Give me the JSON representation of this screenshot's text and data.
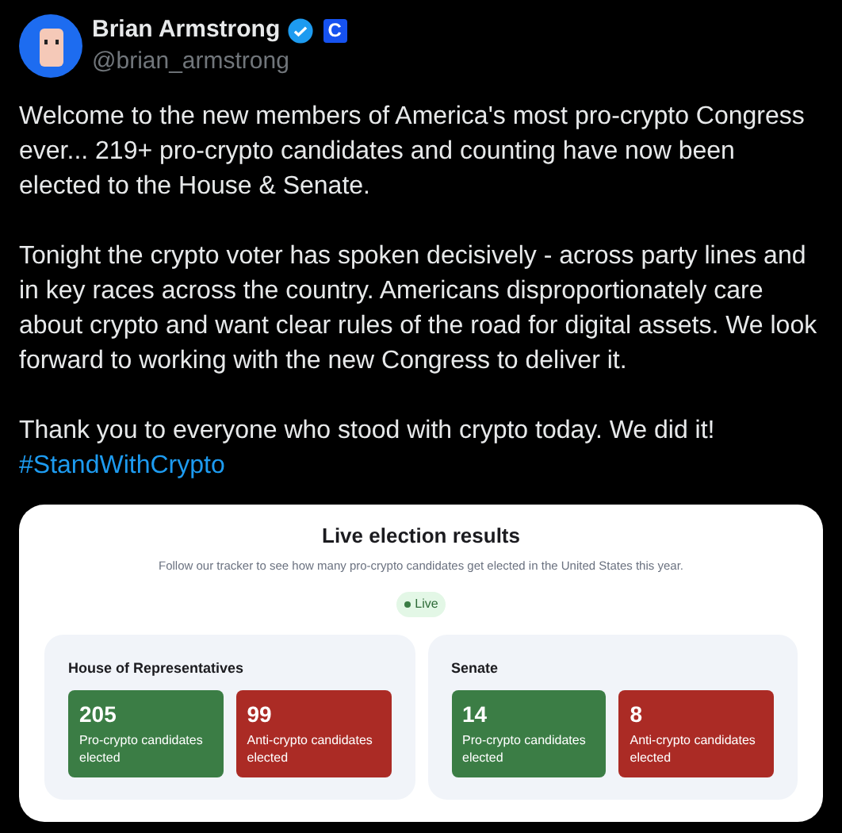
{
  "author": {
    "name": "Brian Armstrong",
    "verified": true,
    "affiliate_badge": "C",
    "handle": "@brian_armstrong"
  },
  "paragraphs": [
    "Welcome to the new members of America's most pro-crypto Congress ever... 219+ pro-crypto candidates and counting have now been elected to the House & Senate.",
    "Tonight the crypto voter has spoken decisively - across party lines and in key races across the country. Americans disproportionately care about crypto and want clear rules of the road for digital assets. We look forward to working with the new Congress to deliver it.",
    "Thank you to everyone who stood with crypto today. We did it!"
  ],
  "hashtag": "#StandWithCrypto",
  "embed": {
    "title": "Live election results",
    "subtitle": "Follow our tracker to see how many pro-crypto candidates get elected in the United States this year.",
    "status": "Live",
    "chambers": [
      {
        "name": "House of Representatives",
        "stats": [
          {
            "kind": "pro",
            "count": "205",
            "label": "Pro-crypto candidates elected"
          },
          {
            "kind": "anti",
            "count": "99",
            "label": "Anti-crypto candidates elected"
          }
        ]
      },
      {
        "name": "Senate",
        "stats": [
          {
            "kind": "pro",
            "count": "14",
            "label": "Pro-crypto candidates elected"
          },
          {
            "kind": "anti",
            "count": "8",
            "label": "Anti-crypto candidates elected"
          }
        ]
      }
    ]
  }
}
